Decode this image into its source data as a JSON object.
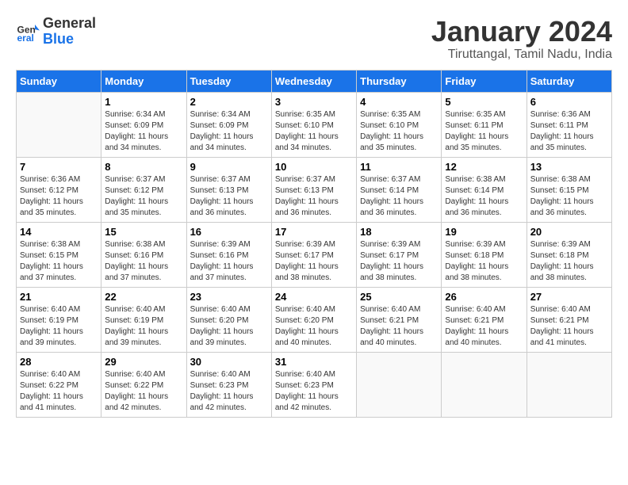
{
  "logo": {
    "line1": "General",
    "line2": "Blue"
  },
  "title": "January 2024",
  "subtitle": "Tiruttangal, Tamil Nadu, India",
  "headers": [
    "Sunday",
    "Monday",
    "Tuesday",
    "Wednesday",
    "Thursday",
    "Friday",
    "Saturday"
  ],
  "weeks": [
    [
      {
        "day": "",
        "info": ""
      },
      {
        "day": "1",
        "info": "Sunrise: 6:34 AM\nSunset: 6:09 PM\nDaylight: 11 hours\nand 34 minutes."
      },
      {
        "day": "2",
        "info": "Sunrise: 6:34 AM\nSunset: 6:09 PM\nDaylight: 11 hours\nand 34 minutes."
      },
      {
        "day": "3",
        "info": "Sunrise: 6:35 AM\nSunset: 6:10 PM\nDaylight: 11 hours\nand 34 minutes."
      },
      {
        "day": "4",
        "info": "Sunrise: 6:35 AM\nSunset: 6:10 PM\nDaylight: 11 hours\nand 35 minutes."
      },
      {
        "day": "5",
        "info": "Sunrise: 6:35 AM\nSunset: 6:11 PM\nDaylight: 11 hours\nand 35 minutes."
      },
      {
        "day": "6",
        "info": "Sunrise: 6:36 AM\nSunset: 6:11 PM\nDaylight: 11 hours\nand 35 minutes."
      }
    ],
    [
      {
        "day": "7",
        "info": "Sunrise: 6:36 AM\nSunset: 6:12 PM\nDaylight: 11 hours\nand 35 minutes."
      },
      {
        "day": "8",
        "info": "Sunrise: 6:37 AM\nSunset: 6:12 PM\nDaylight: 11 hours\nand 35 minutes."
      },
      {
        "day": "9",
        "info": "Sunrise: 6:37 AM\nSunset: 6:13 PM\nDaylight: 11 hours\nand 36 minutes."
      },
      {
        "day": "10",
        "info": "Sunrise: 6:37 AM\nSunset: 6:13 PM\nDaylight: 11 hours\nand 36 minutes."
      },
      {
        "day": "11",
        "info": "Sunrise: 6:37 AM\nSunset: 6:14 PM\nDaylight: 11 hours\nand 36 minutes."
      },
      {
        "day": "12",
        "info": "Sunrise: 6:38 AM\nSunset: 6:14 PM\nDaylight: 11 hours\nand 36 minutes."
      },
      {
        "day": "13",
        "info": "Sunrise: 6:38 AM\nSunset: 6:15 PM\nDaylight: 11 hours\nand 36 minutes."
      }
    ],
    [
      {
        "day": "14",
        "info": "Sunrise: 6:38 AM\nSunset: 6:15 PM\nDaylight: 11 hours\nand 37 minutes."
      },
      {
        "day": "15",
        "info": "Sunrise: 6:38 AM\nSunset: 6:16 PM\nDaylight: 11 hours\nand 37 minutes."
      },
      {
        "day": "16",
        "info": "Sunrise: 6:39 AM\nSunset: 6:16 PM\nDaylight: 11 hours\nand 37 minutes."
      },
      {
        "day": "17",
        "info": "Sunrise: 6:39 AM\nSunset: 6:17 PM\nDaylight: 11 hours\nand 38 minutes."
      },
      {
        "day": "18",
        "info": "Sunrise: 6:39 AM\nSunset: 6:17 PM\nDaylight: 11 hours\nand 38 minutes."
      },
      {
        "day": "19",
        "info": "Sunrise: 6:39 AM\nSunset: 6:18 PM\nDaylight: 11 hours\nand 38 minutes."
      },
      {
        "day": "20",
        "info": "Sunrise: 6:39 AM\nSunset: 6:18 PM\nDaylight: 11 hours\nand 38 minutes."
      }
    ],
    [
      {
        "day": "21",
        "info": "Sunrise: 6:40 AM\nSunset: 6:19 PM\nDaylight: 11 hours\nand 39 minutes."
      },
      {
        "day": "22",
        "info": "Sunrise: 6:40 AM\nSunset: 6:19 PM\nDaylight: 11 hours\nand 39 minutes."
      },
      {
        "day": "23",
        "info": "Sunrise: 6:40 AM\nSunset: 6:20 PM\nDaylight: 11 hours\nand 39 minutes."
      },
      {
        "day": "24",
        "info": "Sunrise: 6:40 AM\nSunset: 6:20 PM\nDaylight: 11 hours\nand 40 minutes."
      },
      {
        "day": "25",
        "info": "Sunrise: 6:40 AM\nSunset: 6:21 PM\nDaylight: 11 hours\nand 40 minutes."
      },
      {
        "day": "26",
        "info": "Sunrise: 6:40 AM\nSunset: 6:21 PM\nDaylight: 11 hours\nand 40 minutes."
      },
      {
        "day": "27",
        "info": "Sunrise: 6:40 AM\nSunset: 6:21 PM\nDaylight: 11 hours\nand 41 minutes."
      }
    ],
    [
      {
        "day": "28",
        "info": "Sunrise: 6:40 AM\nSunset: 6:22 PM\nDaylight: 11 hours\nand 41 minutes."
      },
      {
        "day": "29",
        "info": "Sunrise: 6:40 AM\nSunset: 6:22 PM\nDaylight: 11 hours\nand 42 minutes."
      },
      {
        "day": "30",
        "info": "Sunrise: 6:40 AM\nSunset: 6:23 PM\nDaylight: 11 hours\nand 42 minutes."
      },
      {
        "day": "31",
        "info": "Sunrise: 6:40 AM\nSunset: 6:23 PM\nDaylight: 11 hours\nand 42 minutes."
      },
      {
        "day": "",
        "info": ""
      },
      {
        "day": "",
        "info": ""
      },
      {
        "day": "",
        "info": ""
      }
    ]
  ]
}
